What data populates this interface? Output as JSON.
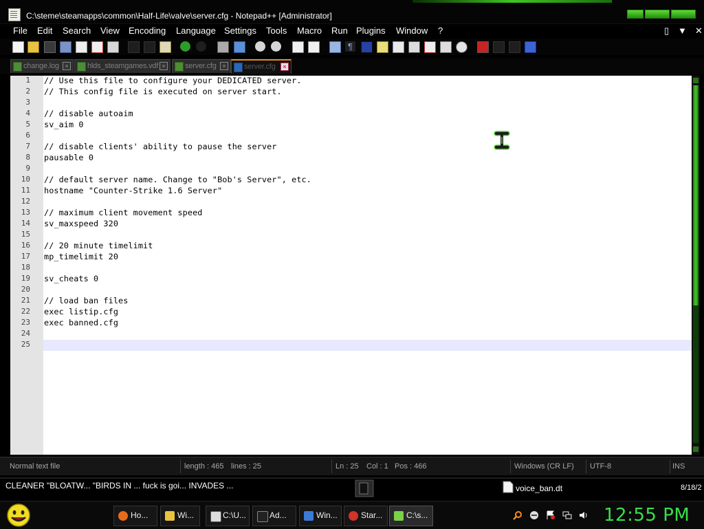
{
  "window": {
    "title": "C:\\steme\\steamapps\\common\\Half-Life\\valve\\server.cfg - Notepad++ [Administrator]",
    "controls_right": [
      "▯",
      "▼",
      "✕"
    ]
  },
  "menu": {
    "items": [
      "File",
      "Edit",
      "Search",
      "View",
      "Encoding",
      "Language",
      "Settings",
      "Tools",
      "Macro",
      "Run",
      "Plugins",
      "Window",
      "?"
    ]
  },
  "tabs": [
    {
      "label": "change.log",
      "active": false
    },
    {
      "label": "hlds_steamgames.vdf",
      "active": false
    },
    {
      "label": "server.cfg",
      "active": false
    },
    {
      "label": "server.cfg",
      "active": true
    }
  ],
  "editor": {
    "line_numbers": [
      "1",
      "2",
      "3",
      "4",
      "5",
      "6",
      "7",
      "8",
      "9",
      "10",
      "11",
      "12",
      "13",
      "14",
      "15",
      "16",
      "17",
      "18",
      "19",
      "20",
      "21",
      "22",
      "23",
      "24",
      "25"
    ],
    "lines": [
      "// Use this file to configure your DEDICATED server.",
      "// This config file is executed on server start.",
      "",
      "// disable autoaim",
      "sv_aim 0",
      "",
      "// disable clients' ability to pause the server",
      "pausable 0",
      "",
      "// default server name. Change to \"Bob's Server\", etc.",
      "hostname \"Counter-Strike 1.6 Server\"",
      "",
      "// maximum client movement speed",
      "sv_maxspeed 320",
      "",
      "// 20 minute timelimit",
      "mp_timelimit 20",
      "",
      "sv_cheats 0",
      "",
      "// load ban files",
      "exec listip.cfg",
      "exec banned.cfg",
      "",
      ""
    ],
    "current_line": 25
  },
  "status": {
    "file_type": "Normal text file",
    "length": "length : 465",
    "lines": "lines : 25",
    "ln": "Ln : 25",
    "col": "Col : 1",
    "pos": "Pos : 466",
    "eol": "Windows (CR LF)",
    "encoding": "UTF-8",
    "mode": "INS"
  },
  "desktop": {
    "windows_strip": "CLEANER \"BLOATW...  \"BIRDS IN ...  fuck is goi...  INVADES ...",
    "file_label": "voice_ban.dt",
    "date_label": "8/18/2"
  },
  "taskbar": {
    "items": [
      {
        "label": "Ho...",
        "icon": "firefox-icon",
        "color": "#e66b1a"
      },
      {
        "label": "Wi...",
        "icon": "folder-icon",
        "color": "#e8c341"
      },
      {
        "label": "C:\\U...",
        "icon": "7zip-icon",
        "color": "#dddddd"
      },
      {
        "label": "Ad...",
        "icon": "cmd-icon",
        "color": "#888888"
      },
      {
        "label": "Win...",
        "icon": "network-icon",
        "color": "#3b7bd8"
      },
      {
        "label": "Star...",
        "icon": "steam-icon",
        "color": "#d2332b"
      },
      {
        "label": "C:\\s...",
        "icon": "notepadpp-icon",
        "color": "#7bd14a",
        "active": true
      }
    ],
    "clock": "12:55 PM"
  },
  "colors": {
    "accent_green": "#37e04b",
    "tab_active_border": "#e78a1e",
    "current_line_bg": "#e8e8ff"
  }
}
